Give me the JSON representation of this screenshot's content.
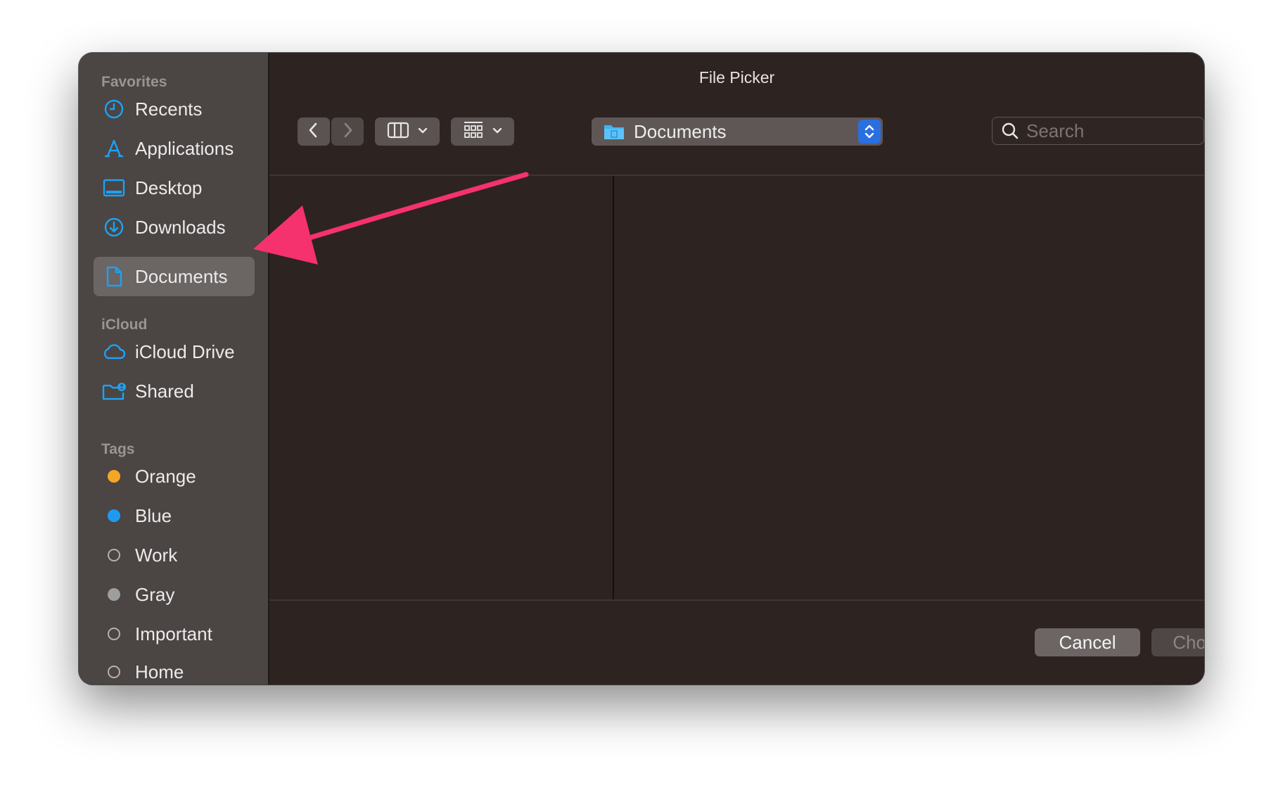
{
  "window": {
    "title": "File Picker"
  },
  "sidebar": {
    "favorites_title": "Favorites",
    "favorites": [
      {
        "label": "Recents",
        "icon": "clock-icon"
      },
      {
        "label": "Applications",
        "icon": "applications-icon"
      },
      {
        "label": "Desktop",
        "icon": "desktop-icon"
      },
      {
        "label": "Downloads",
        "icon": "downloads-icon"
      },
      {
        "label": "Documents",
        "icon": "document-icon",
        "selected": true
      }
    ],
    "icloud_title": "iCloud",
    "icloud": [
      {
        "label": "iCloud Drive",
        "icon": "cloud-icon"
      },
      {
        "label": "Shared",
        "icon": "shared-folder-icon"
      }
    ],
    "tags_title": "Tags",
    "tags": [
      {
        "label": "Orange",
        "color": "#f5a623"
      },
      {
        "label": "Blue",
        "color": "#1e9bf0"
      },
      {
        "label": "Work",
        "color": ""
      },
      {
        "label": "Gray",
        "color": "#9e9e9e"
      },
      {
        "label": "Important",
        "color": ""
      },
      {
        "label": "Home",
        "color": ""
      }
    ]
  },
  "toolbar": {
    "back_icon": "chevron-left-icon",
    "forward_icon": "chevron-right-icon",
    "view_icon": "columns-view-icon",
    "group_icon": "grid-group-icon",
    "location_label": "Documents",
    "search_placeholder": "Search"
  },
  "footer": {
    "cancel_label": "Cancel",
    "choose_label": "Choose"
  },
  "colors": {
    "accent": "#2a6fe0",
    "icon_blue": "#1aa3f5",
    "annotation_arrow": "#f5316e"
  }
}
